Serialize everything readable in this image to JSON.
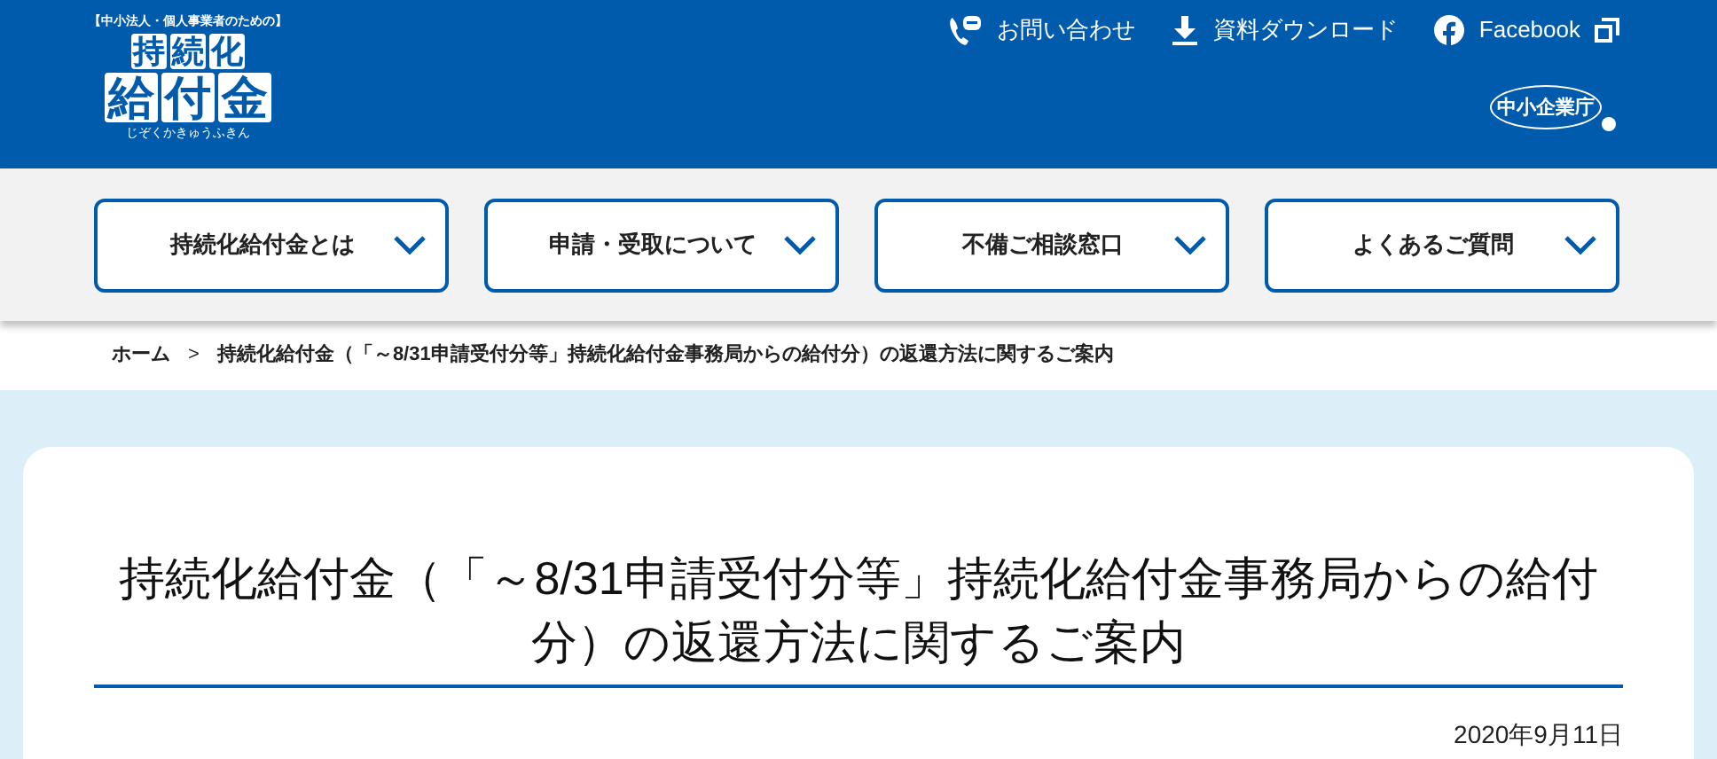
{
  "header": {
    "logo": {
      "tagline": "【中小法人・個人事業者のための】",
      "line_1": "持続化",
      "line_2": "給付金",
      "reading": "じぞくかきゅうふきん"
    },
    "links": [
      {
        "kind": "contact",
        "label": "お問い合わせ"
      },
      {
        "kind": "download",
        "label": "資料ダウンロード"
      },
      {
        "kind": "facebook",
        "label": "Facebook"
      }
    ],
    "agency_logo": "中小企業庁"
  },
  "nav": [
    {
      "label": "持続化給付金とは"
    },
    {
      "label": "申請・受取について"
    },
    {
      "label": "不備ご相談窓口"
    },
    {
      "label": "よくあるご質問"
    }
  ],
  "breadcrumb_separator": ">",
  "breadcrumb": [
    "ホーム",
    "持続化給付金（「～8/31申請受付分等」持続化給付金事務局からの給付分）の返還方法に関するご案内"
  ],
  "article": {
    "title": "持続化給付金（「～8/31申請受付分等」持続化給付金事務局からの給付分）の返還方法に関するご案内",
    "date": "2020年9月11日"
  }
}
